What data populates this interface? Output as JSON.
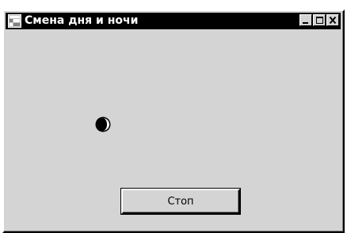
{
  "window": {
    "title": "Смена дня и ночи",
    "controls": {
      "minimize_icon": "minimize-icon",
      "maximize_icon": "maximize-icon",
      "close_icon": "close-icon"
    }
  },
  "content": {
    "indicator_icon": "moon-phase-icon",
    "stop_button_label": "Стоп"
  },
  "colors": {
    "titlebar": "#000000",
    "window_bg": "#d4d4d4",
    "title_text": "#ffffff"
  }
}
